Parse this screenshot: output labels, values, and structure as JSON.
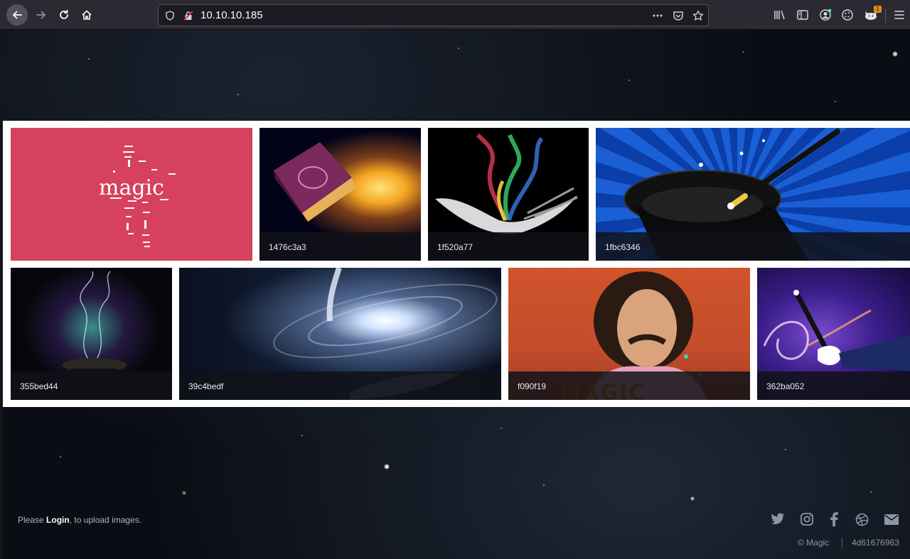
{
  "browser": {
    "url": "10.10.10.185",
    "notification_count": "1"
  },
  "page": {
    "logo_text": "magic",
    "gallery": [
      {
        "caption": "1476c3a3",
        "subject": "glowing-book"
      },
      {
        "caption": "1f520a77",
        "subject": "rainbow-smoke-hand"
      },
      {
        "caption": "1fbc6346",
        "subject": "magic-hat-wand"
      },
      {
        "caption": "355bed44",
        "subject": "sparkling-hat"
      },
      {
        "caption": "39c4bedf",
        "subject": "galaxy-hand"
      },
      {
        "caption": "f090f19",
        "subject": "magician-portrait"
      },
      {
        "caption": "362ba052",
        "subject": "wand-sparkles"
      }
    ],
    "gallery_banner_text": "MAGIC"
  },
  "footer": {
    "login_prefix": "Please ",
    "login_link": "Login",
    "login_suffix": ", to upload images.",
    "copyright": "© Magic",
    "id": "4d61676963",
    "social_icons": [
      "twitter-icon",
      "instagram-icon",
      "facebook-icon",
      "dribbble-icon",
      "envelope-icon"
    ]
  },
  "colors": {
    "logo_tile_bg": "#d6415d",
    "gallery_bg": "#ffffff",
    "page_bg": "#0a0d13"
  }
}
